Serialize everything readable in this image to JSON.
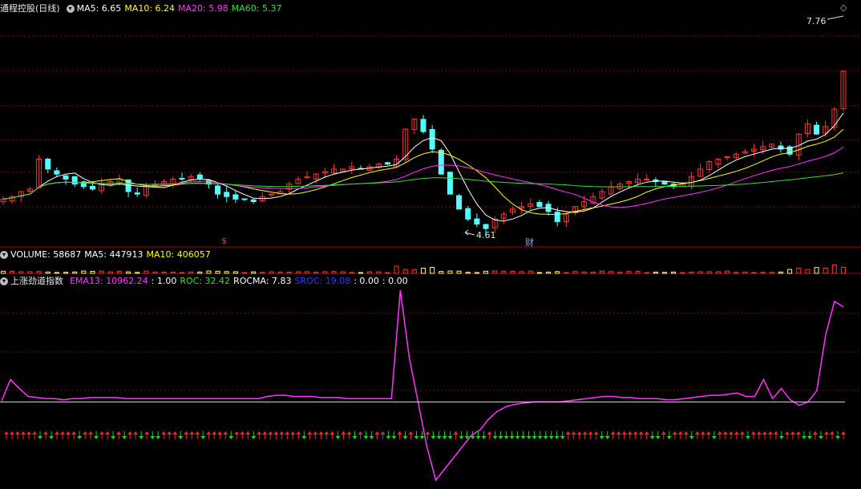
{
  "window": {
    "stock_title": "通程控股(日线)",
    "diamond": "◇"
  },
  "price_panel": {
    "indicators": [
      {
        "label": "MA5:",
        "value": "6.65",
        "color": "#ffffff"
      },
      {
        "label": "MA10:",
        "value": "6.24",
        "color": "#ffff00"
      },
      {
        "label": "MA20:",
        "value": "5.98",
        "color": "#ff33ff"
      },
      {
        "label": "MA60:",
        "value": "5.37",
        "color": "#33dd33"
      }
    ],
    "high_label": "7.76",
    "low_label": "4.61",
    "marker_s": "$",
    "marker_cai": "财"
  },
  "volume_panel": {
    "indicators": [
      {
        "label": "VOLUME:",
        "value": "58687",
        "color": "#ffffff"
      },
      {
        "label": "MA5:",
        "value": "447913",
        "color": "#ffffff"
      },
      {
        "label": "MA10:",
        "value": "406057",
        "color": "#ffff00"
      }
    ]
  },
  "indicator_panel": {
    "title": "上涨劲道指数",
    "indicators": [
      {
        "label": "EMA13:",
        "value": "10962.24",
        "color": "#ff33ff"
      },
      {
        "label": ":",
        "value": "1.00",
        "color": "#ffffff"
      },
      {
        "label": "ROC:",
        "value": "32.42",
        "color": "#33dd33"
      },
      {
        "label": "ROCMA:",
        "value": "7.83",
        "color": "#ffffff"
      },
      {
        "label": "SROC:",
        "value": "19.08",
        "color": "#3333ff"
      },
      {
        "label": ":",
        "value": "0.00",
        "color": "#ffffff"
      },
      {
        "label": ":",
        "value": "0.00",
        "color": "#ffffff"
      }
    ]
  },
  "colors": {
    "up": "#ff3232",
    "down": "#54ffff",
    "grid": "#8b0000",
    "ema": "#ff33ff",
    "ma5": "#ffffff",
    "ma10": "#ffff00",
    "ma20": "#ff33ff",
    "ma60": "#33dd33",
    "arrow_up": "#ff2020",
    "arrow_down": "#22cc22"
  },
  "chart_data": {
    "type": "candlestick",
    "close_price_path": [
      5.2,
      5.25,
      5.35,
      5.4,
      6.0,
      5.8,
      5.7,
      5.6,
      5.5,
      5.45,
      5.4,
      5.5,
      5.55,
      5.6,
      5.35,
      5.3,
      5.45,
      5.5,
      5.55,
      5.6,
      5.6,
      5.65,
      5.6,
      5.5,
      5.3,
      5.25,
      5.2,
      5.2,
      5.15,
      5.25,
      5.3,
      5.35,
      5.5,
      5.6,
      5.65,
      5.7,
      5.75,
      5.8,
      5.8,
      5.85,
      5.8,
      5.85,
      5.9,
      5.9,
      6.0,
      6.6,
      6.8,
      6.55,
      6.2,
      5.7,
      5.3,
      5.0,
      4.8,
      4.7,
      4.61,
      4.8,
      4.9,
      5.0,
      5.05,
      5.1,
      5.05,
      4.95,
      4.75,
      4.9,
      5.05,
      5.15,
      5.25,
      5.35,
      5.45,
      5.5,
      5.55,
      5.6,
      5.6,
      5.55,
      5.5,
      5.45,
      5.5,
      5.65,
      5.8,
      5.95,
      6.0,
      6.05,
      6.1,
      6.15,
      6.2,
      6.25,
      6.3,
      6.2,
      6.1,
      6.5,
      6.7,
      6.5,
      6.65,
      7.0,
      7.76
    ],
    "ema13_path": [
      1,
      20,
      12,
      5,
      4,
      3,
      3,
      2,
      3,
      3,
      4,
      4,
      4,
      4,
      3,
      3,
      3,
      3,
      3,
      3,
      3,
      3,
      3,
      3,
      3,
      3,
      3,
      3,
      3,
      3,
      5,
      6,
      6,
      5,
      5,
      5,
      4,
      4,
      4,
      3,
      3,
      3,
      3,
      3,
      3,
      100,
      40,
      0,
      -40,
      -70,
      -60,
      -50,
      -40,
      -30,
      -25,
      -15,
      -8,
      -4,
      -2,
      -1,
      0,
      0,
      0,
      0,
      1,
      2,
      3,
      4,
      5,
      5,
      4,
      4,
      3,
      3,
      3,
      2,
      2,
      3,
      4,
      5,
      6,
      6,
      7,
      8,
      5,
      5,
      20,
      3,
      12,
      2,
      -3,
      0,
      10,
      60,
      90,
      85
    ]
  }
}
